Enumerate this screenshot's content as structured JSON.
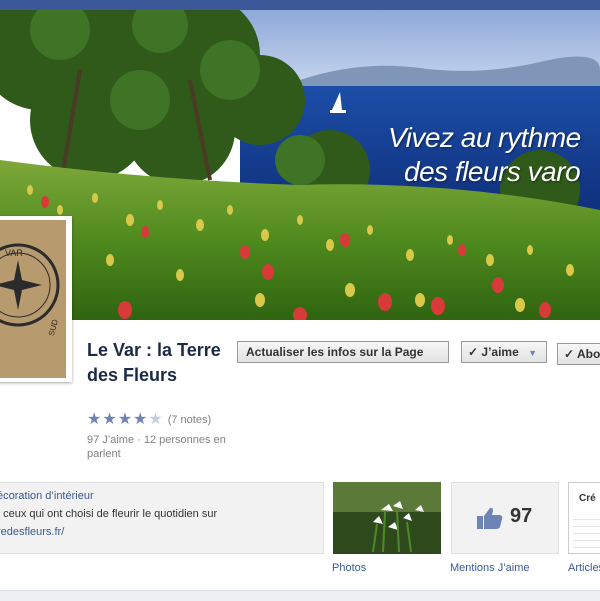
{
  "cover": {
    "tagline_line1": "Vivez au rythme",
    "tagline_line2": "des fleurs varo"
  },
  "profile": {
    "name": "Le Var : la Terre des Fleurs",
    "rating_stars": 4,
    "rating_max": 5,
    "rating_count": "(7 notes)",
    "stats": "97 J’aime · 12 personnes en parlent"
  },
  "buttons": {
    "update": "Actualiser les infos sur la Page",
    "like": "J’aime",
    "third": "Abo"
  },
  "about": {
    "category": "écoration d’intérieur",
    "description": "t ceux qui ont choisi de fleurir le quotidien sur",
    "url": "redesfleurs.fr/"
  },
  "tiles": {
    "photos_label": "Photos",
    "likes_label": "Mentions J’aime",
    "likes_count": "97",
    "articles_label": "Articles",
    "articles_header": "Cré"
  },
  "colors": {
    "facebook_blue": "#3b5998",
    "name_color": "#1c2a47",
    "star_color": "#6d84b4"
  }
}
